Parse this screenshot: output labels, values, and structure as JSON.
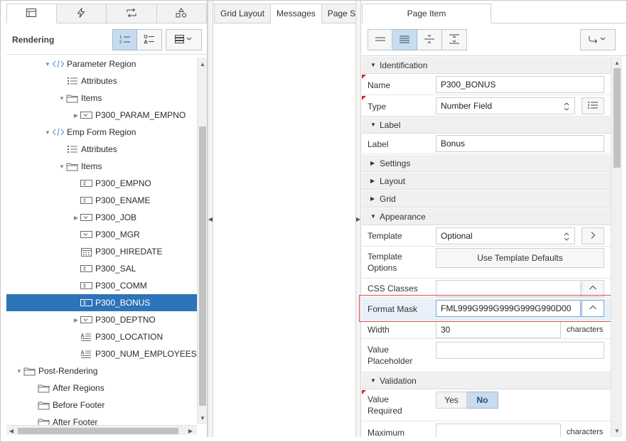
{
  "left": {
    "tabs": [
      {
        "icon": "rendering-tree-icon"
      },
      {
        "icon": "dynamic-actions-icon"
      },
      {
        "icon": "processing-icon"
      },
      {
        "icon": "shared-components-icon"
      }
    ],
    "title": "Rendering",
    "tree": [
      {
        "label": "Parameter Region",
        "toggle": "▼",
        "icon": "region-code-icon"
      },
      {
        "label": "Attributes",
        "toggle": "",
        "icon": "attributes-list-icon"
      },
      {
        "label": "Items",
        "toggle": "▼",
        "icon": "folder-icon"
      },
      {
        "label": "P300_PARAM_EMPNO",
        "toggle": "▶",
        "icon": "select-list-item-icon"
      },
      {
        "label": "Emp Form Region",
        "toggle": "▼",
        "icon": "region-code-icon"
      },
      {
        "label": "Attributes",
        "toggle": "",
        "icon": "attributes-list-icon"
      },
      {
        "label": "Items",
        "toggle": "▼",
        "icon": "folder-icon"
      },
      {
        "label": "P300_EMPNO",
        "toggle": "",
        "icon": "text-item-icon"
      },
      {
        "label": "P300_ENAME",
        "toggle": "",
        "icon": "text-item-icon"
      },
      {
        "label": "P300_JOB",
        "toggle": "▶",
        "icon": "select-list-item-icon"
      },
      {
        "label": "P300_MGR",
        "toggle": "",
        "icon": "select-list-item-icon"
      },
      {
        "label": "P300_HIREDATE",
        "toggle": "",
        "icon": "date-picker-item-icon"
      },
      {
        "label": "P300_SAL",
        "toggle": "",
        "icon": "text-item-icon"
      },
      {
        "label": "P300_COMM",
        "toggle": "",
        "icon": "text-item-icon"
      },
      {
        "label": "P300_BONUS",
        "toggle": "",
        "icon": "text-item-icon"
      },
      {
        "label": "P300_DEPTNO",
        "toggle": "▶",
        "icon": "select-list-item-icon"
      },
      {
        "label": "P300_LOCATION",
        "toggle": "",
        "icon": "textarea-item-icon"
      },
      {
        "label": "P300_NUM_EMPLOYEES",
        "toggle": "",
        "icon": "textarea-item-icon"
      },
      {
        "label": "Post-Rendering",
        "toggle": "▼",
        "icon": "folder-icon"
      },
      {
        "label": "After Regions",
        "toggle": "",
        "icon": "folder-icon"
      },
      {
        "label": "Before Footer",
        "toggle": "",
        "icon": "folder-icon"
      },
      {
        "label": "After Footer",
        "toggle": "",
        "icon": "folder-icon"
      }
    ]
  },
  "middle": {
    "tabs": [
      "Grid Layout",
      "Messages",
      "Page S"
    ]
  },
  "right": {
    "tab": "Page Item",
    "groups": {
      "identification": "Identification",
      "label": "Label",
      "settings": "Settings",
      "layout": "Layout",
      "grid": "Grid",
      "appearance": "Appearance",
      "validation": "Validation"
    },
    "props": {
      "name_label": "Name",
      "name_value": "P300_BONUS",
      "type_label": "Type",
      "type_value": "Number Field",
      "label_label": "Label",
      "label_value": "Bonus",
      "template_label": "Template",
      "template_value": "Optional",
      "template_options_label": "Template Options",
      "template_options_button": "Use Template Defaults",
      "css_classes_label": "CSS Classes",
      "css_classes_value": "",
      "format_mask_label": "Format Mask",
      "format_mask_value": "FML999G999G999G999G990D00",
      "width_label": "Width",
      "width_value": "30",
      "width_suffix": "characters",
      "placeholder_label": "Value Placeholder",
      "placeholder_value": "",
      "value_required_label": "Value Required",
      "yes": "Yes",
      "no": "No",
      "maximum_label": "Maximum",
      "maximum_suffix": "characters"
    }
  }
}
